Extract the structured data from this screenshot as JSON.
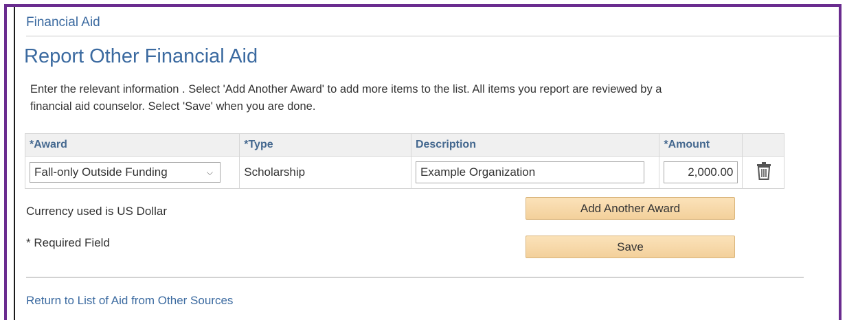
{
  "breadcrumb": "Financial Aid",
  "title": "Report Other Financial Aid",
  "instructions": "Enter the relevant information . Select 'Add Another Award' to add more items to the list. All items you report are reviewed by a financial aid counselor.  Select 'Save' when you are done.",
  "table": {
    "columns": [
      "*Award",
      "*Type",
      "Description",
      "*Amount"
    ],
    "rows": [
      {
        "award": "Fall-only Outside Funding",
        "type": "Scholarship",
        "description": "Example Organization",
        "amount": "2,000.00"
      }
    ]
  },
  "currency_note": "Currency used is US Dollar",
  "required_note": "* Required Field",
  "buttons": {
    "add_award": "Add Another Award",
    "save": "Save"
  },
  "return_link": "Return to List of Aid from Other Sources",
  "colors": {
    "frame": "#6a2c8f",
    "heading": "#3b6aa0",
    "button_bg": "#f6d7a7"
  },
  "icons": {
    "delete": "trash-icon",
    "dropdown": "chevron-down-icon"
  }
}
